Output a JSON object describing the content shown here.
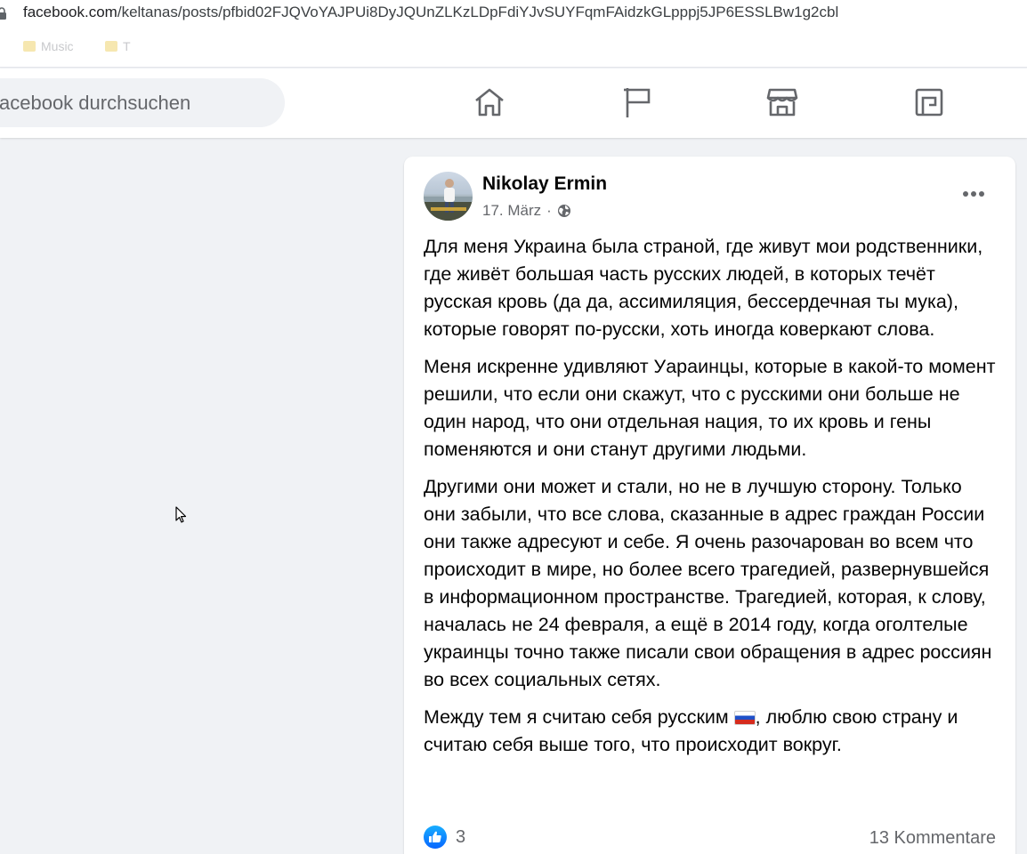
{
  "browser": {
    "url_domain": "facebook.com",
    "url_path": "/keltanas/posts/pfbid02FJQVoYAJPUi8DyJQUnZLKzLDpFdiYJvSUYFqmFAidzkGLpppj5JP6ESSLBw1g2cbl",
    "bookmarks": [
      "Music",
      "T"
    ]
  },
  "nav": {
    "search_placeholder": "acebook durchsuchen",
    "icons": [
      "home-icon",
      "flag-icon",
      "marketplace-icon",
      "gaming-icon"
    ]
  },
  "post": {
    "author": "Nikolay Ermin",
    "date": "17. März",
    "separator": "·",
    "privacy_icon": "globe-icon",
    "paragraphs": [
      "Для меня Украина была страной, где живут мои родственники, где живёт большая часть русских людей, в которых течёт русская кровь (да да, ассимиляция, бессердечная ты мука), которые говорят по-русски, хоть иногда коверкают слова.",
      "Меня искренне удивляют Уараинцы, которые в какой-то момент решили, что если они скажут, что с русскими они больше не один народ, что они отдельная нация, то их кровь и гены поменяются и они станут другими людьми.",
      "Другими они может и стали, но не в лучшую сторону. Только они забыли, что все слова, сказанные в адрес граждан России они также адресуют и себе. Я очень разочарован во всем что происходит в мире, но более всего трагедией, развернувшейся в информационном пространстве. Трагедией, которая, к слову, началась не 24 февраля, а ещё в 2014 году, когда оголтелые украинцы точно также писали свои обращения в адрес россиян во всех социальных сетях."
    ],
    "last_paragraph_before_flag": "Между тем я считаю себя русским ",
    "last_paragraph_after_flag": ", люблю свою страну и считаю себя выше того, что происходит вокруг.",
    "like_count": "3",
    "comments": "13 Kommentare"
  },
  "colors": {
    "background": "#f0f2f5",
    "card": "#ffffff",
    "secondary_text": "#65676b",
    "like_blue": "#0866ff"
  }
}
